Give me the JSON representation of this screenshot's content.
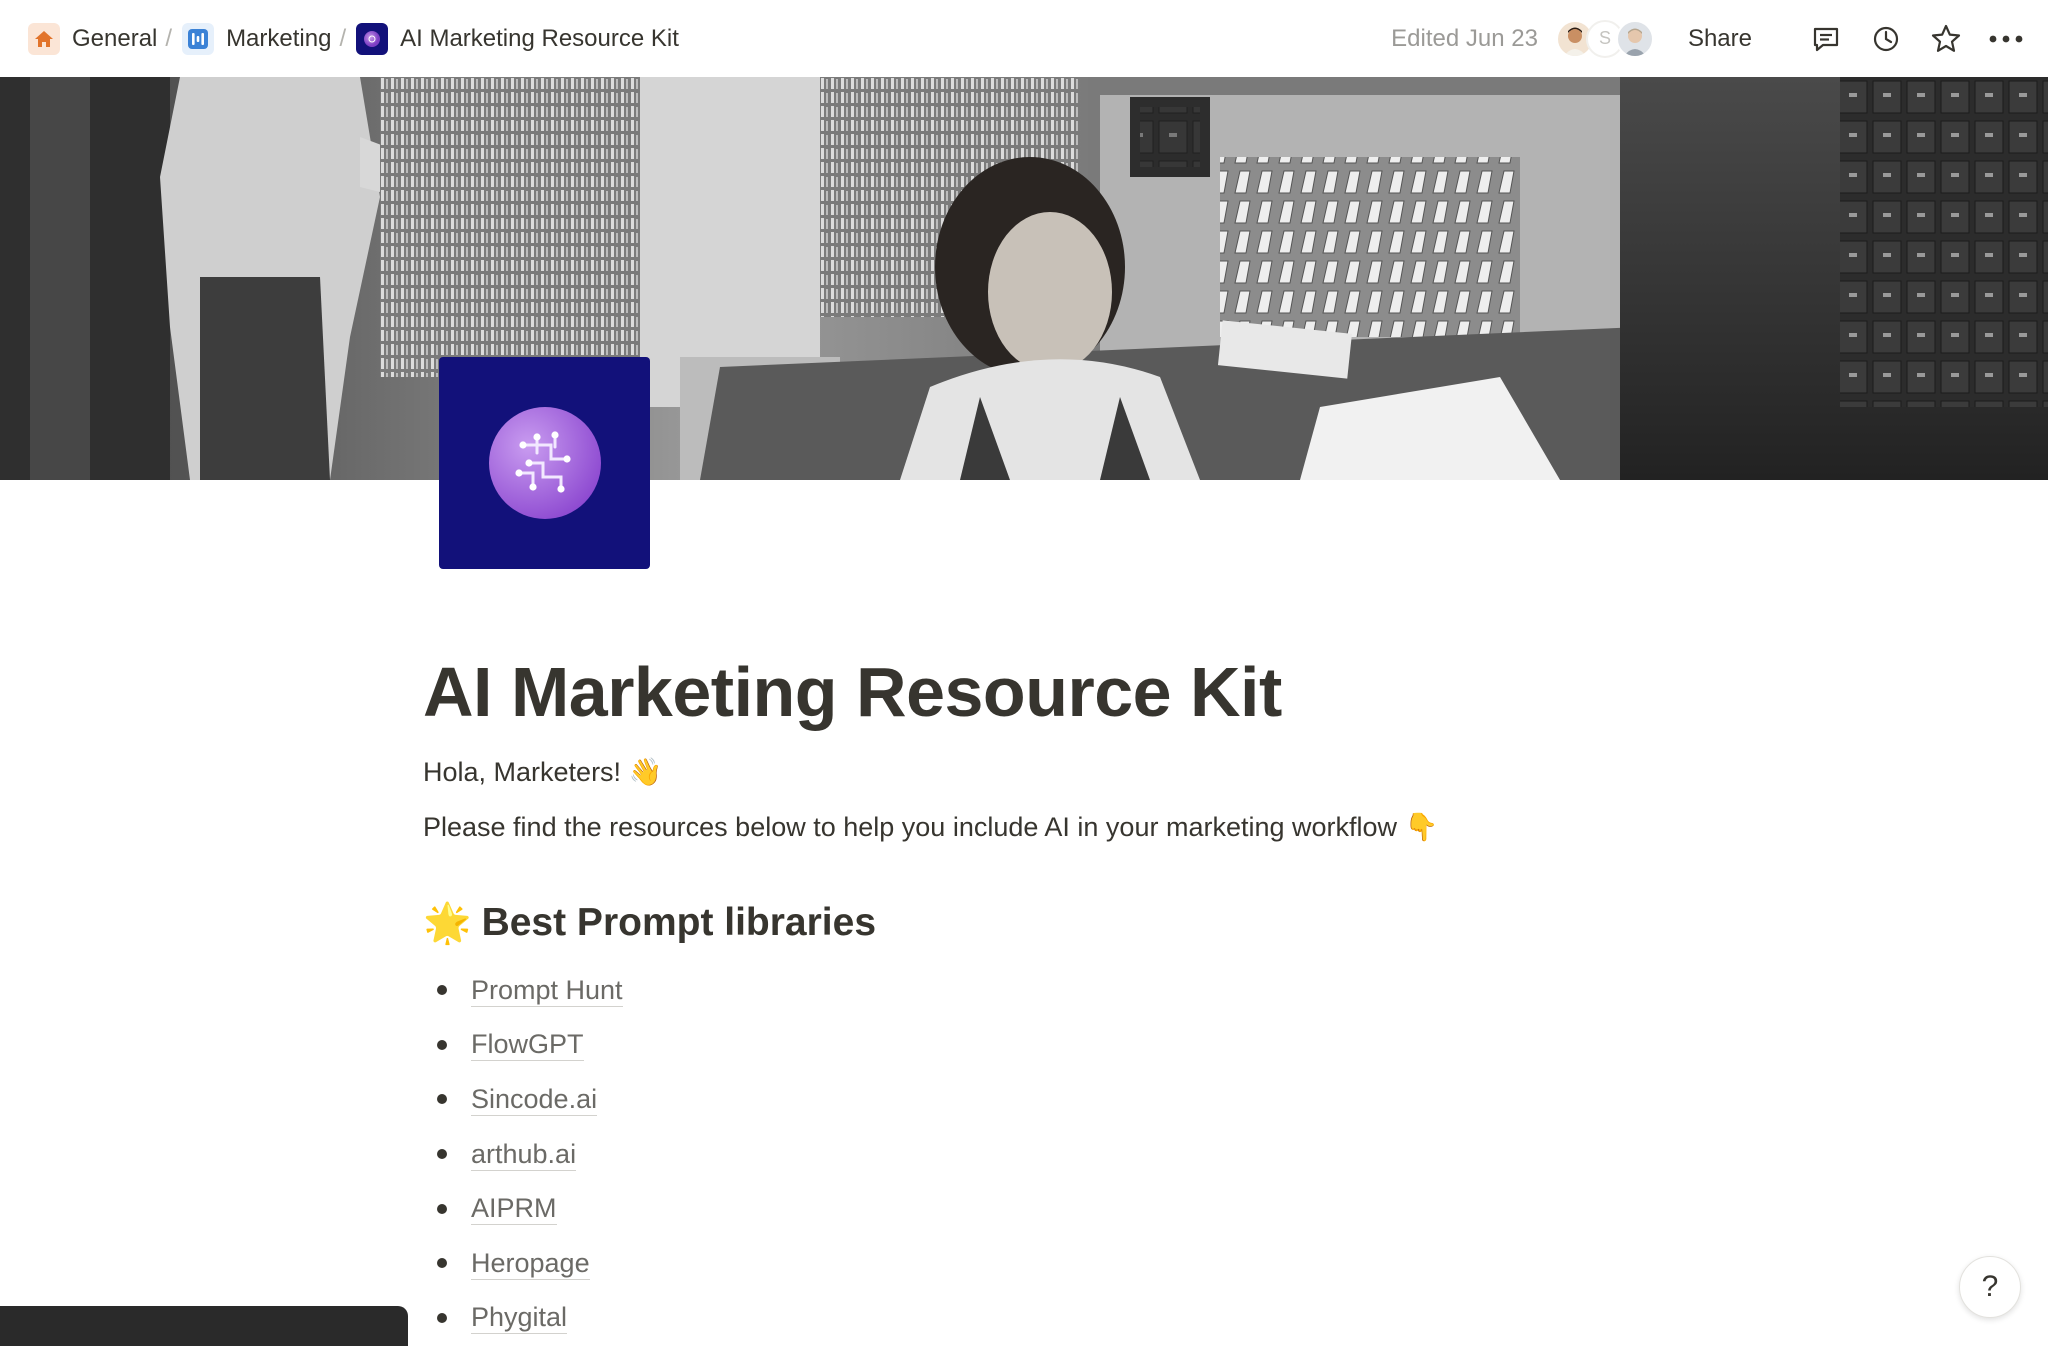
{
  "breadcrumb": {
    "items": [
      {
        "label": "General",
        "icon": "home-icon"
      },
      {
        "label": "Marketing",
        "icon": "chart-icon"
      },
      {
        "label": "AI Marketing Resource Kit",
        "icon": "ai-circle-icon"
      }
    ],
    "separator": "/"
  },
  "header": {
    "edited": "Edited Jun 23",
    "avatar_initial": "S",
    "share_label": "Share"
  },
  "page": {
    "title": "AI Marketing Resource Kit",
    "greeting": "Hola, Marketers! 👋",
    "intro": "Please find the resources below to help you include AI in your marketing workflow 👇",
    "section_heading_emoji": "🌟",
    "section_heading": "Best Prompt libraries",
    "links": [
      "Prompt Hunt",
      "FlowGPT",
      "Sincode.ai",
      "arthub.ai",
      "AIPRM",
      "Heropage",
      "Phygital"
    ]
  },
  "help_label": "?",
  "colors": {
    "icon_bg": "#12117a",
    "icon_accent": "#9b5fd6",
    "text": "#37352f",
    "muted": "#9b9a97"
  }
}
